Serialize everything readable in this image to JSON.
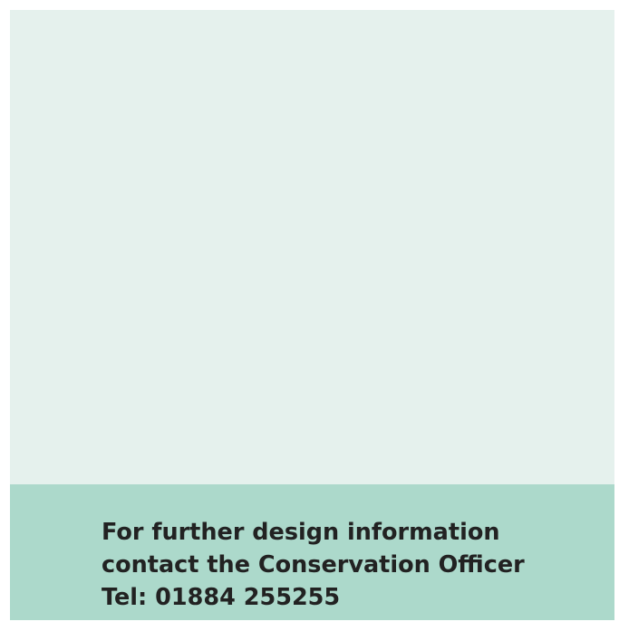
{
  "colors": {
    "panel_background": "#e5f1ed",
    "band_background": "#acd9cb",
    "text": "#222222"
  },
  "contact": {
    "line1": "For further design information",
    "line2": "contact the Conservation Officer",
    "line3": "Tel: 01884 255255"
  }
}
